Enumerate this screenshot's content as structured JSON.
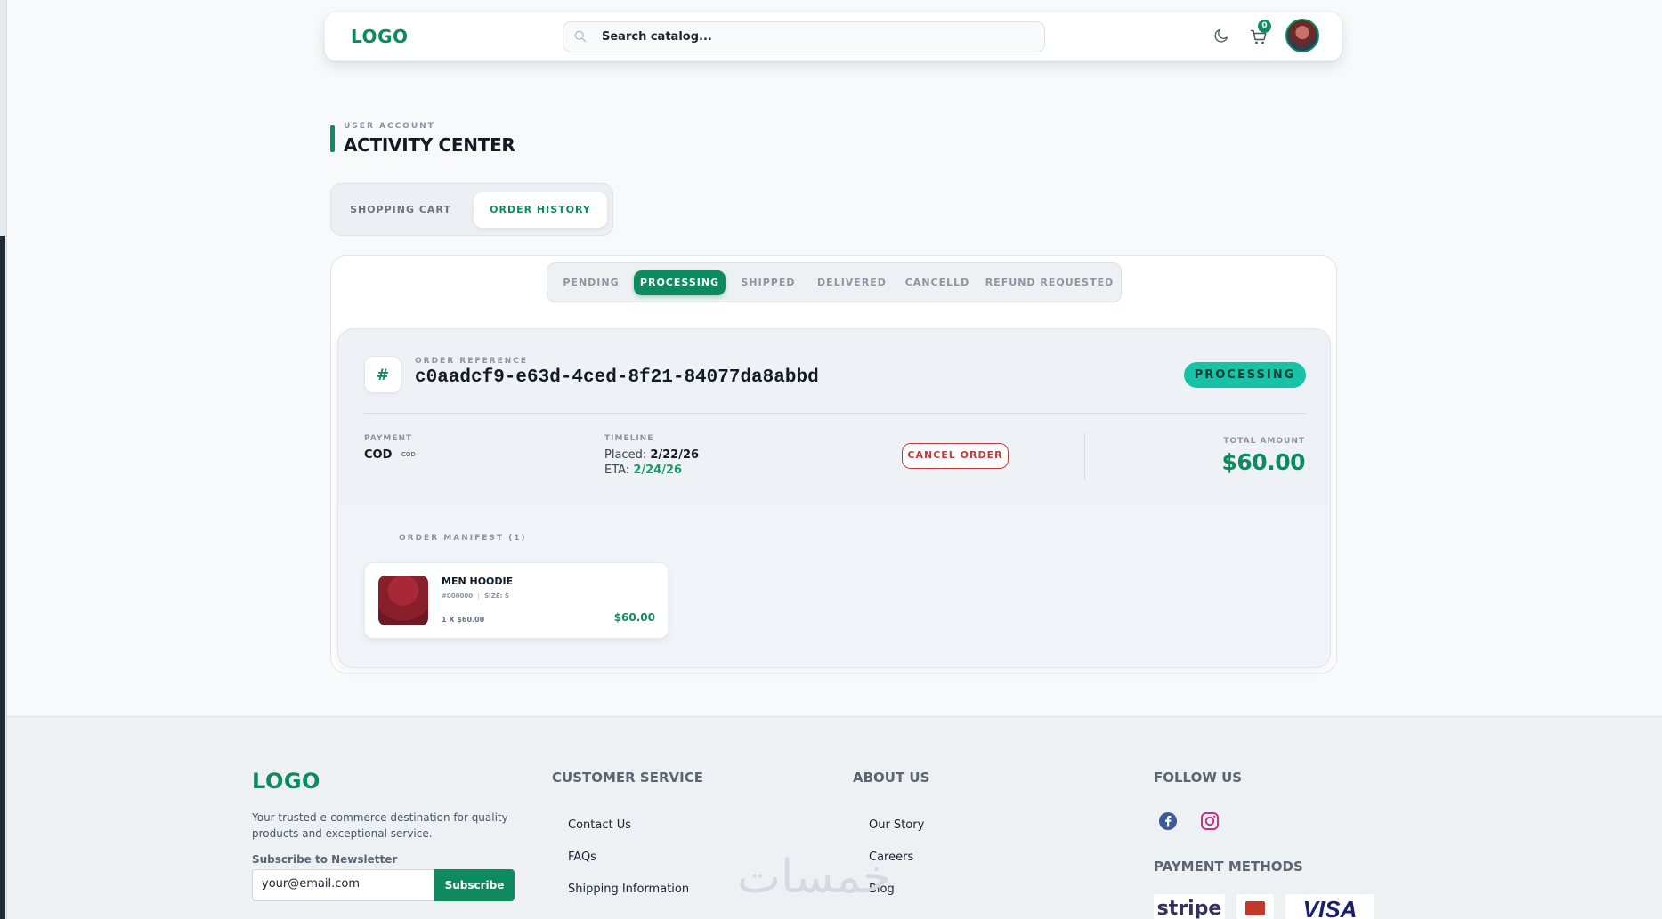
{
  "header": {
    "logo": "LOGO",
    "search_placeholder": "Search catalog...",
    "cart_count": "0"
  },
  "page": {
    "kicker": "USER ACCOUNT",
    "title": "ACTIVITY CENTER"
  },
  "main_tabs": [
    {
      "label": "SHOPPING CART",
      "active": false
    },
    {
      "label": "ORDER HISTORY",
      "active": true
    }
  ],
  "status_tabs": [
    {
      "label": "PENDING",
      "active": false
    },
    {
      "label": "PROCESSING",
      "active": true
    },
    {
      "label": "SHIPPED",
      "active": false
    },
    {
      "label": "DELIVERED",
      "active": false
    },
    {
      "label": "CANCELLD",
      "active": false
    },
    {
      "label": "REFUND REQUESTED",
      "active": false
    }
  ],
  "order": {
    "hash_symbol": "#",
    "ref_label": "ORDER REFERENCE",
    "ref_value": "c0aadcf9-e63d-4ced-8f21-84077da8abbd",
    "status": "PROCESSING",
    "payment_label": "PAYMENT",
    "payment_value": "COD",
    "payment_chip": "COD",
    "timeline_label": "TIMELINE",
    "placed_label": "Placed:",
    "placed_date": "2/22/26",
    "eta_label": "ETA:",
    "eta_date": "2/24/26",
    "cancel_label": "CANCEL ORDER",
    "total_label": "TOTAL AMOUNT",
    "total_value": "$60.00",
    "manifest_label": "ORDER MANIFEST (1)",
    "items": [
      {
        "name": "MEN HOODIE",
        "sku": "#000000",
        "size": "SIZE: S",
        "qty_line": "1 X $60.00",
        "price": "$60.00"
      }
    ]
  },
  "footer": {
    "logo": "LOGO",
    "tagline": "Your trusted e-commerce destination for quality products and exceptional service.",
    "newsletter_label": "Subscribe to Newsletter",
    "email_value": "your@email.com",
    "subscribe_label": "Subscribe",
    "customer_service": {
      "title": "CUSTOMER SERVICE",
      "links": [
        "Contact Us",
        "FAQs",
        "Shipping Information"
      ]
    },
    "about_us": {
      "title": "ABOUT US",
      "links": [
        "Our Story",
        "Careers",
        "Blog"
      ]
    },
    "follow_us": {
      "title": "FOLLOW US",
      "icons": [
        "facebook-icon",
        "instagram-icon"
      ]
    },
    "payment_methods": {
      "title": "PAYMENT METHODS",
      "logos": [
        "stripe",
        "VISA"
      ]
    },
    "watermark": "خمسات"
  },
  "colors": {
    "brand": "#0f8a5f",
    "status_pill": "#17c3a6",
    "danger": "#c53a3a"
  }
}
